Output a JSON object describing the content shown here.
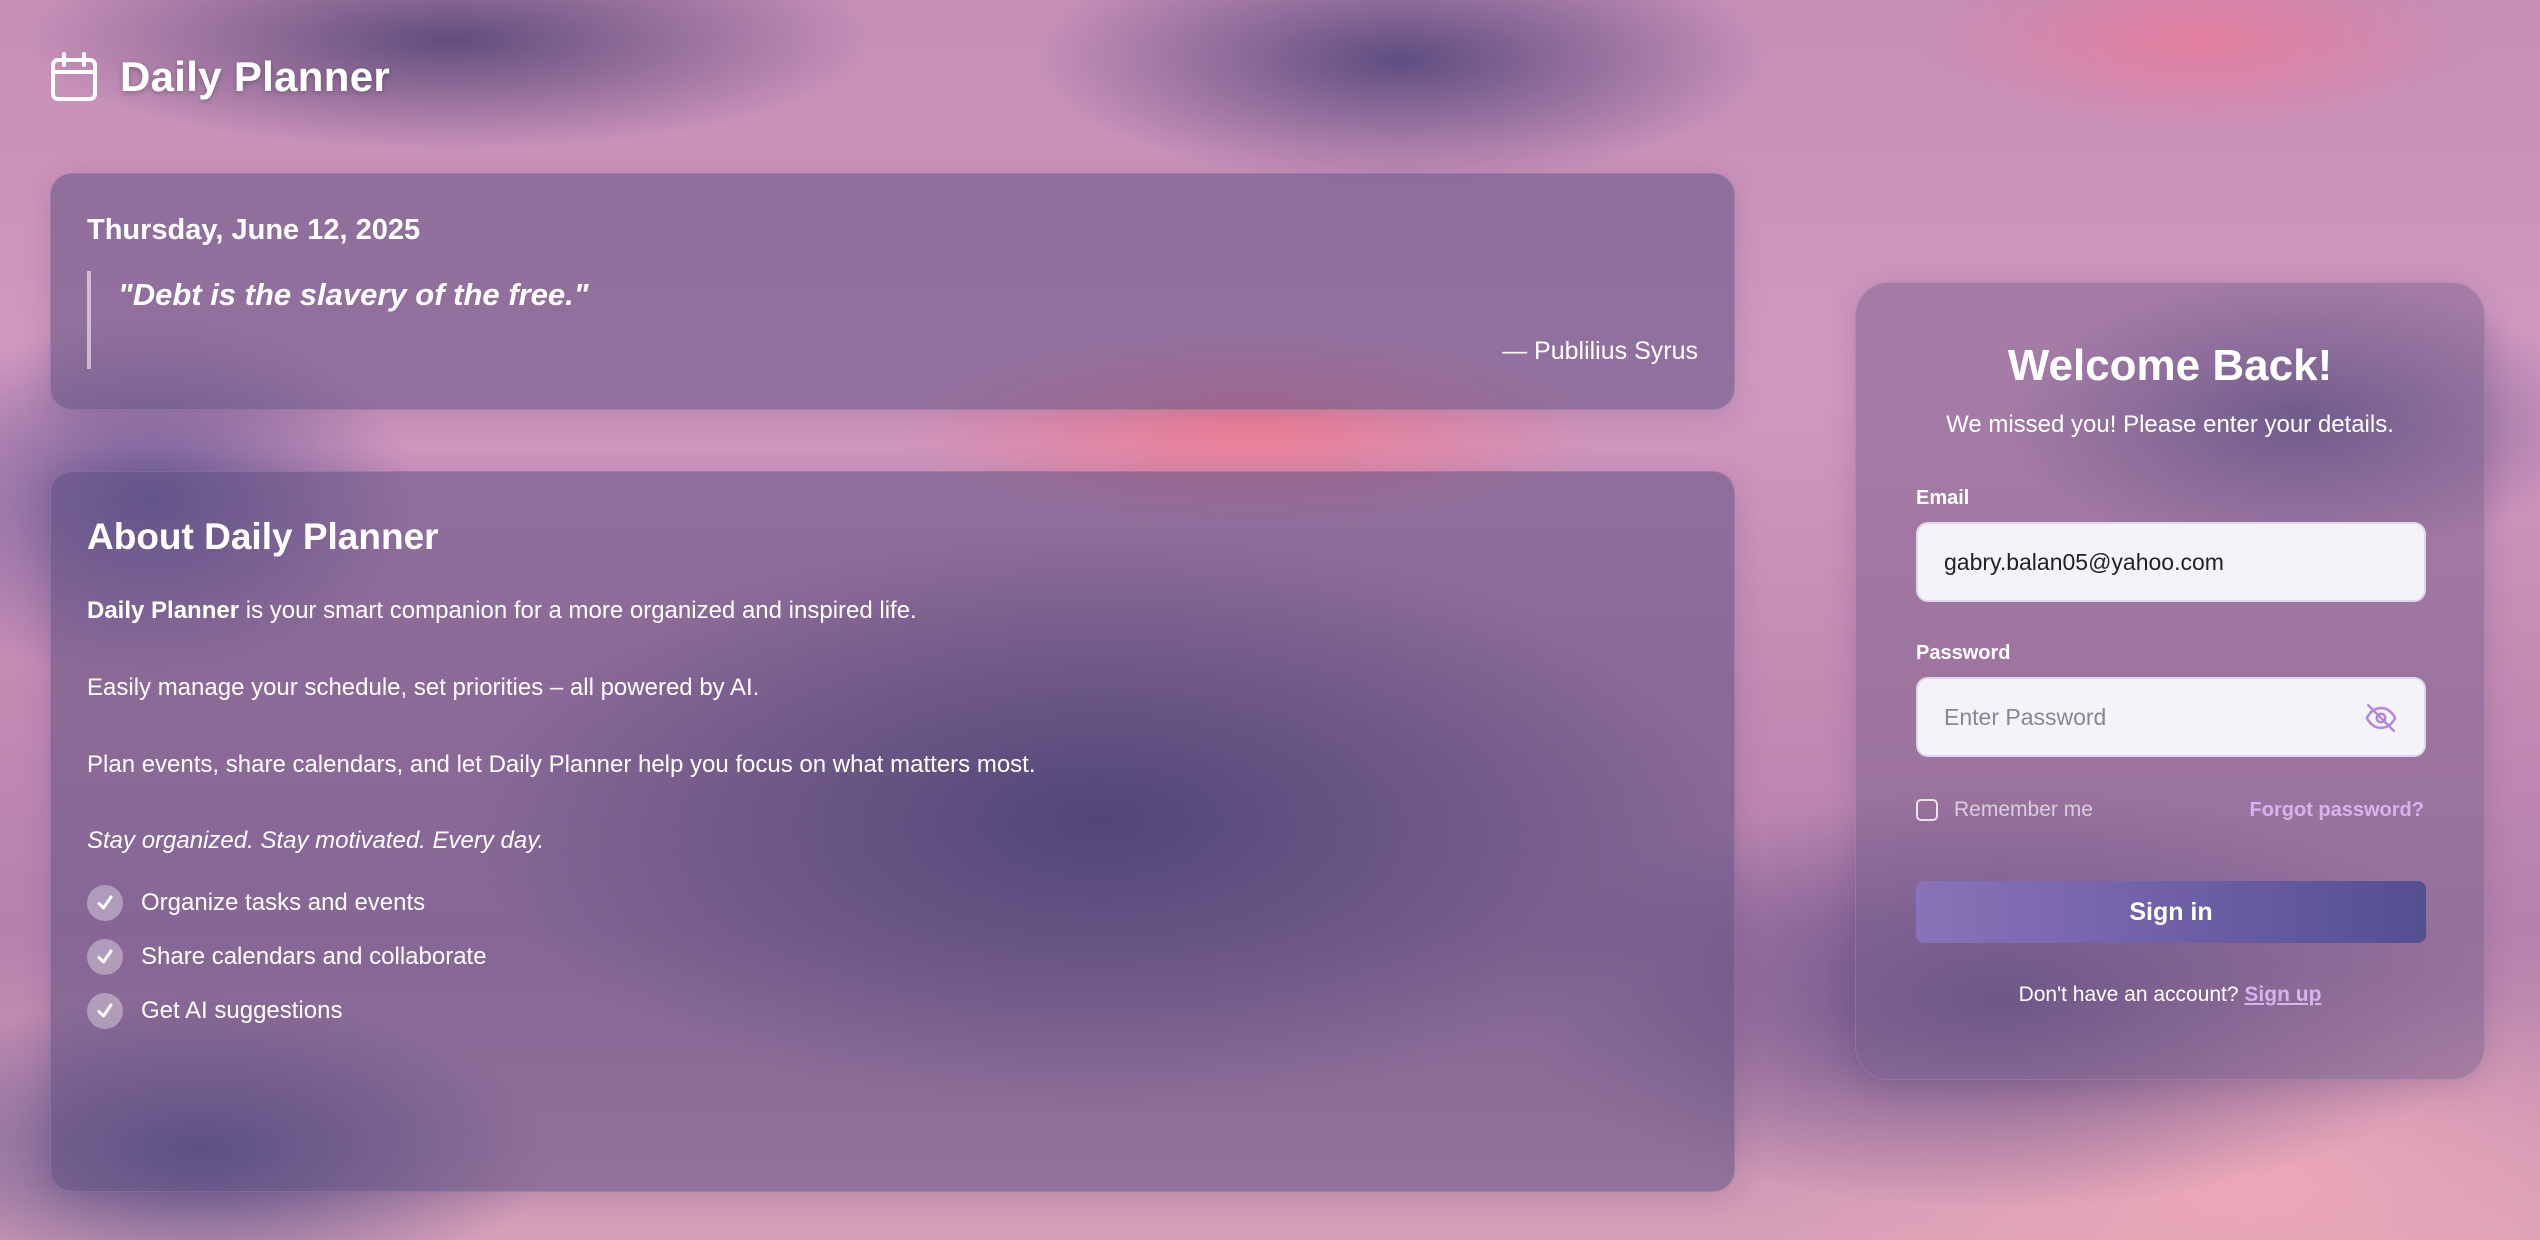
{
  "brand": {
    "icon": "calendar-icon",
    "title": "Daily Planner"
  },
  "quote_card": {
    "date": "Thursday, June 12, 2025",
    "quote": "\"Debt is the slavery of the free.\"",
    "author": "— Publilius Syrus"
  },
  "about": {
    "title": "About Daily Planner",
    "intro_bold": "Daily Planner",
    "intro_rest": " is your smart companion for a more organized and inspired life.",
    "p2": "Easily manage your schedule, set priorities – all powered by AI.",
    "p3": "Plan events, share calendars, and let Daily Planner help you focus on what matters most.",
    "tagline": "Stay organized. Stay motivated. Every day.",
    "features": [
      "Organize tasks and events",
      "Share calendars and collaborate",
      "Get AI suggestions"
    ]
  },
  "login": {
    "title": "Welcome Back!",
    "subtitle": "We missed you! Please enter your details.",
    "email_label": "Email",
    "email_value": "gabry.balan05@yahoo.com",
    "password_label": "Password",
    "password_placeholder": "Enter Password",
    "password_toggle_icon": "eye-off-icon",
    "remember_label": "Remember me",
    "remember_checked": false,
    "forgot_label": "Forgot password?",
    "signin_label": "Sign in",
    "signup_prompt": "Don't have an account? ",
    "signup_link": "Sign up"
  },
  "colors": {
    "accent_link": "#d9b3ef",
    "button_start": "#8a73b8",
    "button_end": "#535090"
  }
}
